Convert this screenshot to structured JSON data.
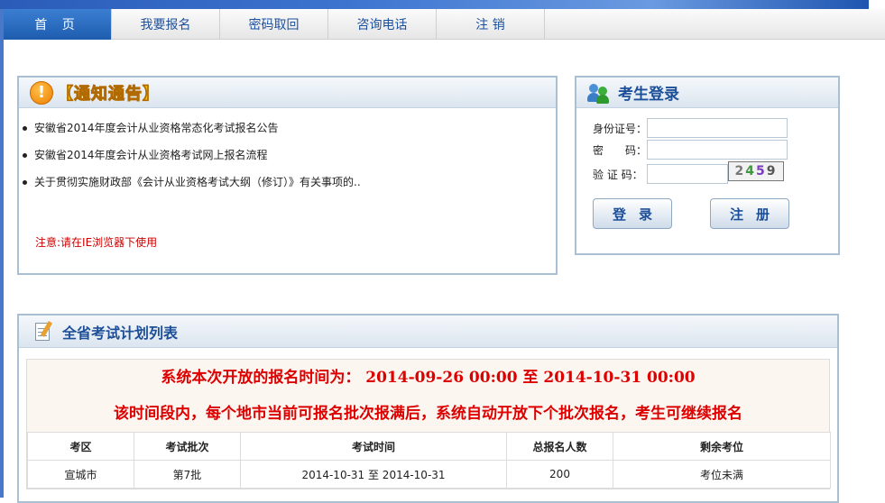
{
  "nav": {
    "items": [
      {
        "label": "首 页",
        "active": true
      },
      {
        "label": "我要报名",
        "active": false
      },
      {
        "label": "密码取回",
        "active": false
      },
      {
        "label": "咨询电话",
        "active": false
      },
      {
        "label": "注 销",
        "active": false
      }
    ]
  },
  "notice": {
    "title": "【通知通告】",
    "items": [
      "安徽省2014年度会计从业资格常态化考试报名公告",
      "安徽省2014年度会计从业资格考试网上报名流程",
      "关于贯彻实施财政部《会计从业资格考试大纲（修订）》有关事项的.."
    ],
    "warning": "注意:请在IE浏览器下使用"
  },
  "login": {
    "title": "考生登录",
    "id_label": "身份证号：",
    "password_label": "密　　码：",
    "captcha_label": "验 证 码：",
    "captcha": [
      "2",
      "4",
      "5",
      "9"
    ],
    "login_button": "登录",
    "register_button": "注册"
  },
  "plan": {
    "title": "全省考试计划列表",
    "message1": "系统本次开放的报名时间为：  2014-09-26 00:00 至  2014-10-31 00:00",
    "message2": "该时间段内，每个地市当前可报名批次报满后，系统自动开放下个批次报名，考生可继续报名",
    "columns": [
      "考区",
      "考试批次",
      "考试时间",
      "总报名人数",
      "剩余考位"
    ],
    "rows": [
      [
        "宣城市",
        "第7批",
        "2014-10-31 至  2014-10-31",
        "200",
        "考位未满"
      ]
    ]
  },
  "colors": {
    "accent": "#1d4f98",
    "alert": "#dd0000",
    "nav_active": "#2a6cc0"
  }
}
